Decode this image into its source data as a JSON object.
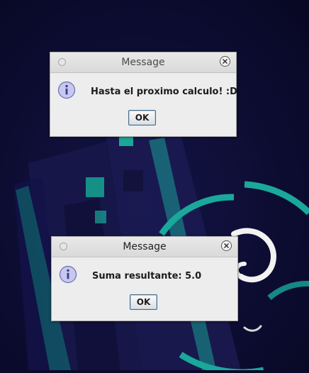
{
  "dialogs": [
    {
      "title": "Message",
      "icon": "info-icon",
      "message": "Hasta el proximo calculo! :D",
      "ok_label": "OK"
    },
    {
      "title": "Message",
      "icon": "info-icon",
      "message": "Suma resultante: 5.0",
      "ok_label": "OK"
    }
  ],
  "colors": {
    "desktop_bg": "#0a0a2a",
    "accent_teal": "#1aa89a",
    "dialog_bg": "#ededed"
  }
}
